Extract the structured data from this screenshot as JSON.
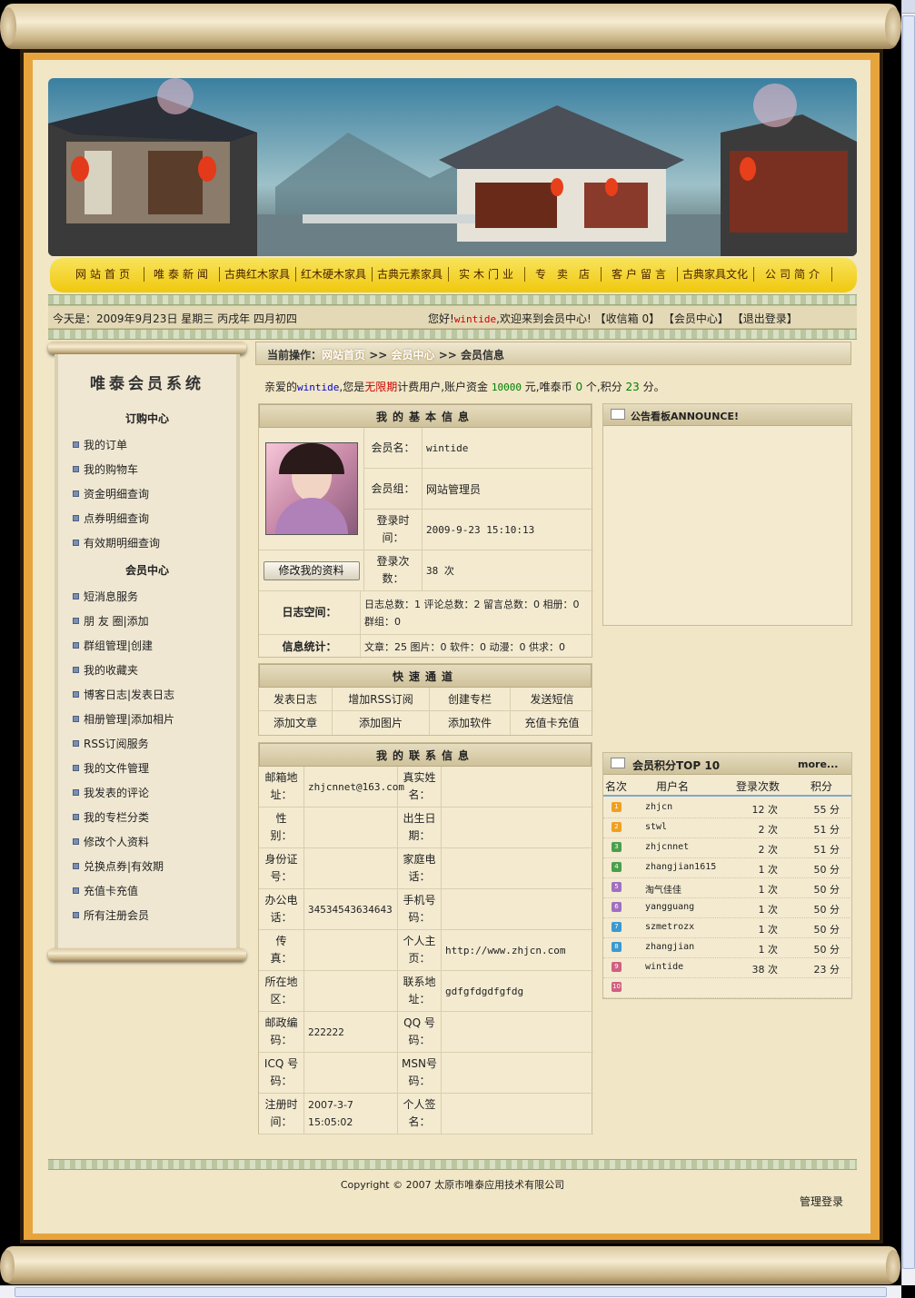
{
  "colors": {
    "accent_red": "#cc0000",
    "link_blue": "#0000cc",
    "money_green": "#008000",
    "nav_yellow": "#f3d12a"
  },
  "nav": {
    "items": [
      "网站首页",
      "唯泰新闻",
      "古典红木家具",
      "红木硬木家具",
      "古典元素家具",
      "实木门业",
      "专　卖　店",
      "客户留言",
      "古典家具文化",
      "公司简介"
    ]
  },
  "infobar": {
    "date": "今天是：2009年9月23日 星期三 丙戌年 四月初四",
    "greeting_prefix": "您好!",
    "username": "wintide",
    "greeting_suffix": ",欢迎来到会员中心!",
    "inbox": "【收信箱 0】",
    "member_center": "【会员中心】",
    "logout": "【退出登录】"
  },
  "sidebar": {
    "title": "唯泰会员系统",
    "section1": "订购中心",
    "section1_items": [
      "我的订单",
      "我的购物车",
      "资金明细查询",
      "点券明细查询",
      "有效期明细查询"
    ],
    "section2": "会员中心",
    "section2_items": [
      "短消息服务",
      "朋 友 圈|添加",
      "群组管理|创建",
      "我的收藏夹",
      "博客日志|发表日志",
      "相册管理|添加相片",
      "RSS订阅服务",
      "我的文件管理",
      "我发表的评论",
      "我的专栏分类",
      "修改个人资料",
      "兑换点券|有效期",
      "充值卡充值",
      "所有注册会员"
    ]
  },
  "breadcrumb": {
    "label": "当前操作：",
    "home": "网站首页",
    "sep": ">>",
    "center": "会员中心",
    "current": "会员信息"
  },
  "welcome": {
    "p1": "亲爱的",
    "username": "wintide",
    "p2": ",您是",
    "period": "无限期",
    "p3": "计费用户,账户资金 ",
    "funds": "10000",
    "p4": " 元,唯泰币 ",
    "coins": "0",
    "p5": " 个,积分 ",
    "points": "23",
    "p6": " 分。"
  },
  "basic_info": {
    "title": "我的基本信息",
    "rows": [
      {
        "label": "会员名：",
        "value": "wintide"
      },
      {
        "label": "会员组：",
        "value": "网站管理员"
      },
      {
        "label": "登录时间：",
        "value": "2009-9-23 15:10:13"
      },
      {
        "label": "登录次数：",
        "value": "38 次"
      }
    ],
    "edit_button": "修改我的资料",
    "blog_label": "日志空间：",
    "blog_value": "日志总数：1 评论总数：2 留言总数：0 相册：0 群组：0",
    "stats_label": "信息统计：",
    "stats_value": "文章：25 图片：0 软件：0 动漫：0 供求：0"
  },
  "quick": {
    "title": "快速通道",
    "items": [
      "发表日志",
      "增加RSS订阅",
      "创建专栏",
      "发送短信",
      "添加文章",
      "添加图片",
      "添加软件",
      "充值卡充值"
    ]
  },
  "contact": {
    "title": "我的联系信息",
    "rows": [
      {
        "l1": "邮箱地址：",
        "v1": "zhjcnnet@163.com",
        "l2": "真实姓名：",
        "v2": ""
      },
      {
        "l1": "性　　别：",
        "v1": "",
        "l2": "出生日期：",
        "v2": ""
      },
      {
        "l1": "身份证号：",
        "v1": "",
        "l2": "家庭电话：",
        "v2": ""
      },
      {
        "l1": "办公电话：",
        "v1": "34534543634643",
        "l2": "手机号码：",
        "v2": ""
      },
      {
        "l1": "传　　真：",
        "v1": "",
        "l2": "个人主页：",
        "v2": "http://www.zhjcn.com"
      },
      {
        "l1": "所在地区：",
        "v1": "",
        "l2": "联系地址：",
        "v2": "gdfgfdgdfgfdg"
      },
      {
        "l1": "邮政编码：",
        "v1": "222222",
        "l2": "QQ 号码：",
        "v2": ""
      },
      {
        "l1": "ICQ 号码：",
        "v1": "",
        "l2": "MSN号码：",
        "v2": ""
      },
      {
        "l1": "注册时间：",
        "v1": "2007-3-7 15:05:02",
        "l2": "个人签名：",
        "v2": ""
      }
    ]
  },
  "announce": {
    "title": "公告看板ANNOUNCE!"
  },
  "ranking": {
    "title": "会员积分TOP 10",
    "more": "more...",
    "headers": [
      "名次",
      "用户名",
      "登录次数",
      "积分"
    ],
    "rows": [
      {
        "rank": "1",
        "name": "zhjcn",
        "logins": "12 次",
        "points": "55 分",
        "color": "#f0a020"
      },
      {
        "rank": "2",
        "name": "stwl",
        "logins": "2 次",
        "points": "51 分",
        "color": "#f0a020"
      },
      {
        "rank": "3",
        "name": "zhjcnnet",
        "logins": "2 次",
        "points": "51 分",
        "color": "#4aa04a"
      },
      {
        "rank": "4",
        "name": "zhangjian1615",
        "logins": "1 次",
        "points": "50 分",
        "color": "#4aa04a"
      },
      {
        "rank": "5",
        "name": "淘气佳佳",
        "logins": "1 次",
        "points": "50 分",
        "color": "#a070c0"
      },
      {
        "rank": "6",
        "name": "yangguang",
        "logins": "1 次",
        "points": "50 分",
        "color": "#a070c0"
      },
      {
        "rank": "7",
        "name": "szmetrozx",
        "logins": "1 次",
        "points": "50 分",
        "color": "#3a9ad0"
      },
      {
        "rank": "8",
        "name": "zhangjian",
        "logins": "1 次",
        "points": "50 分",
        "color": "#3a9ad0"
      },
      {
        "rank": "9",
        "name": "wintide",
        "logins": "38 次",
        "points": "23 分",
        "color": "#d06080"
      },
      {
        "rank": "10",
        "name": "",
        "logins": "",
        "points": "",
        "color": "#d06080"
      }
    ]
  },
  "footer": {
    "copyright": "Copyright © 2007 太原市唯泰应用技术有限公司",
    "admin": "管理登录"
  }
}
